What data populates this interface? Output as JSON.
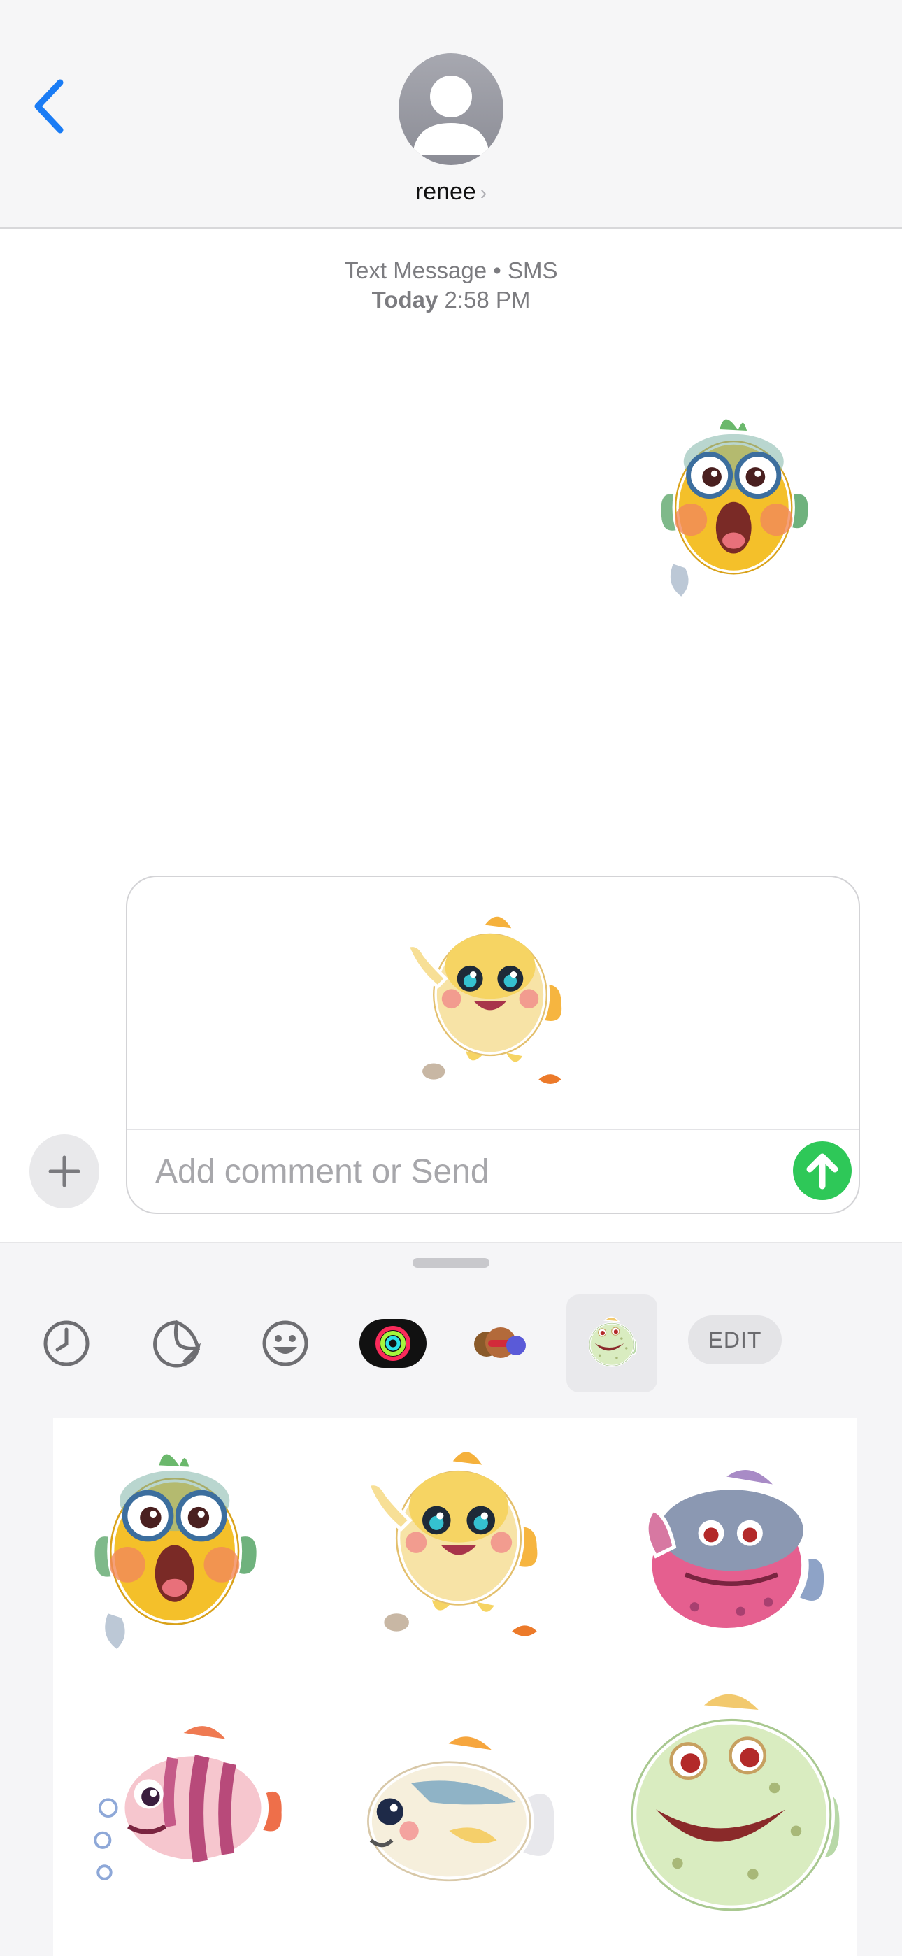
{
  "contact": {
    "name": "renee"
  },
  "conversation": {
    "service_label": "Text Message • SMS",
    "day": "Today",
    "time": "2:58 PM"
  },
  "composer": {
    "placeholder": "Add comment or Send"
  },
  "drawer": {
    "tabs": [
      "recents-clock",
      "stickers",
      "emoji",
      "activity",
      "memoji",
      "custom-sticker-pack"
    ],
    "edit_label": "EDIT"
  },
  "stickers": [
    "shocked-yellow-fish",
    "waving-cream-fish",
    "pink-purple-fish",
    "striped-pink-fish",
    "cream-blue-fish",
    "green-spotted-fish"
  ],
  "colors": {
    "accent_blue": "#1a7cf5",
    "send_green": "#2ec858"
  }
}
